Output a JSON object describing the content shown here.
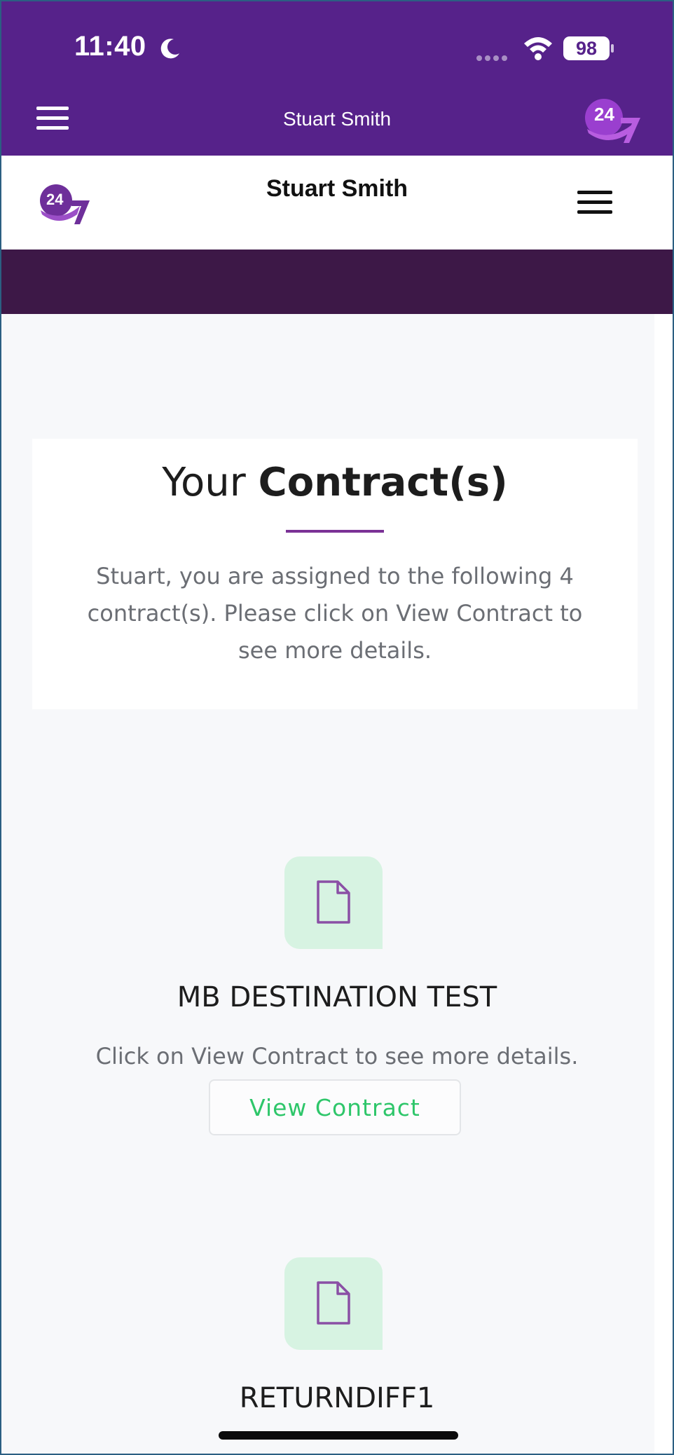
{
  "status_bar": {
    "time": "11:40",
    "battery": "98"
  },
  "app_header": {
    "title": "Stuart Smith",
    "logo_text": "24"
  },
  "site_header": {
    "title": "Stuart Smith",
    "logo_text": "24"
  },
  "intro": {
    "title_regular": "Your ",
    "title_bold": "Contract(s)",
    "text": "Stuart, you are assigned to the following 4 contract(s). Please click on View Contract to see more details."
  },
  "contracts": [
    {
      "name": "MB DESTINATION TEST",
      "description": "Click on View Contract to see more details.",
      "button_label": "View Contract"
    },
    {
      "name": "RETURNDIFF1"
    }
  ],
  "colors": {
    "brand_purple": "#56228a",
    "dark_band": "#3d1847",
    "accent_green": "#2ec66a",
    "icon_bg": "#d7f3e2"
  }
}
